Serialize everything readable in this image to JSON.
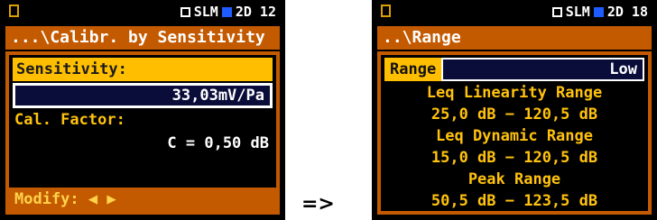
{
  "left": {
    "status": {
      "mode": "SLM",
      "number": "2D 12"
    },
    "title": "...\\Calibr. by Sensitivity",
    "sensitivity_label": "Sensitivity:",
    "sensitivity_value": "33,03mV/Pa",
    "cal_factor_label": "Cal. Factor:",
    "cal_factor_value": "C = 0,50 dB",
    "footer": "Modify: ◀ ▶"
  },
  "arrow": "=>",
  "right": {
    "status": {
      "mode": "SLM",
      "number": "2D 18"
    },
    "title": "..\\Range",
    "range_label": "Range",
    "range_value": "Low",
    "leq_linearity_label": "Leq Linearity Range",
    "leq_linearity_value": "25,0 dB − 120,5 dB",
    "leq_dynamic_label": "Leq Dynamic Range",
    "leq_dynamic_value": "15,0 dB − 120,5 dB",
    "peak_label": "Peak Range",
    "peak_value": "50,5 dB − 123,5 dB"
  },
  "colors": {
    "title_bar": "#c45a00",
    "highlight": "#ffbf00",
    "text": "#ffc20e",
    "value_box": "#0a0d3a",
    "background": "#000000"
  }
}
